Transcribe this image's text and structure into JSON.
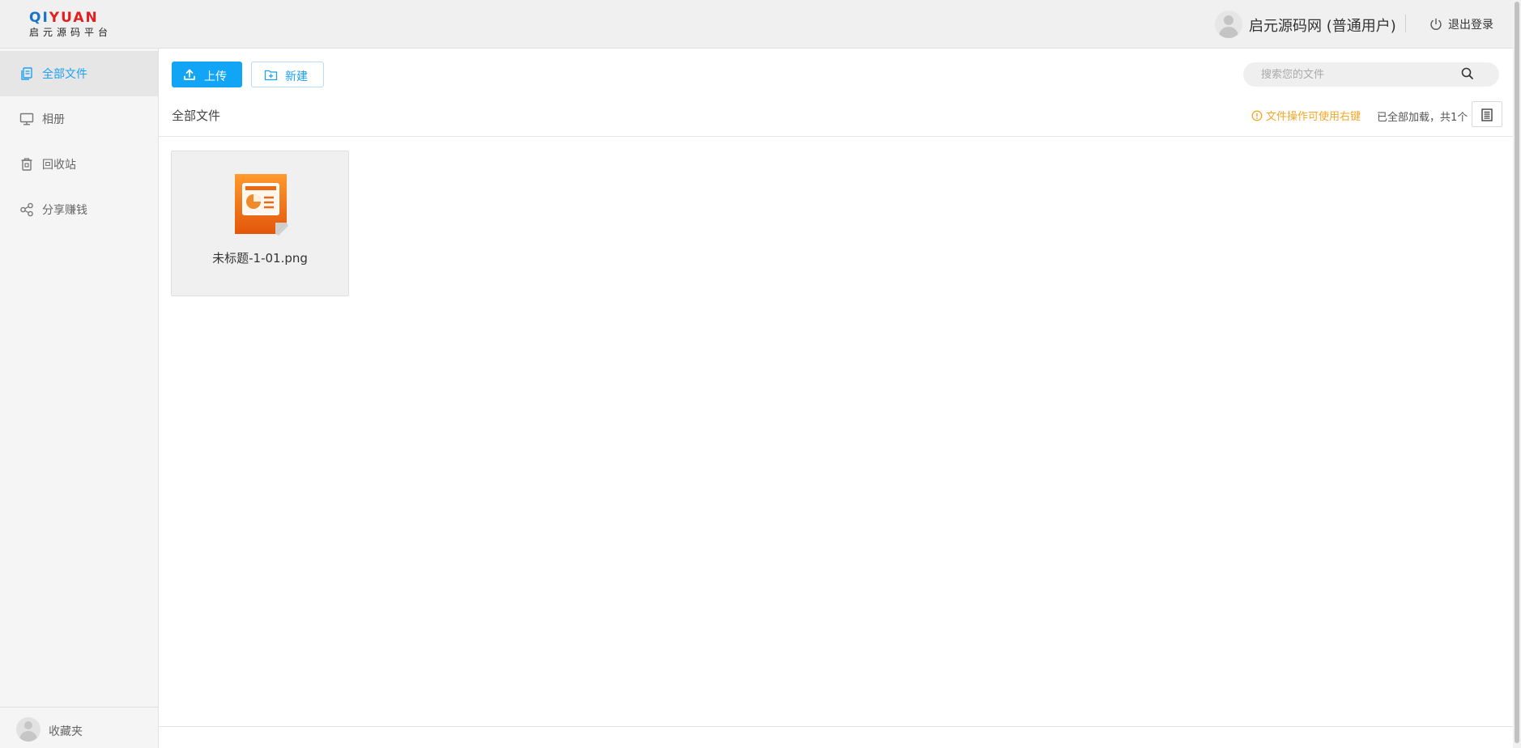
{
  "header": {
    "logo": {
      "top_text": "QIYUAN",
      "bottom_text": "启元源码平台"
    },
    "user_name": "启元源码网 (普通用户)",
    "logout_label": "退出登录"
  },
  "sidebar": {
    "items": [
      {
        "label": "全部文件",
        "icon": "files-icon",
        "active": true
      },
      {
        "label": "相册",
        "icon": "monitor-icon",
        "active": false
      },
      {
        "label": "回收站",
        "icon": "trash-icon",
        "active": false
      },
      {
        "label": "分享赚钱",
        "icon": "share-icon",
        "active": false
      }
    ],
    "footer_label": "收藏夹"
  },
  "toolbar": {
    "upload_label": "上传",
    "new_label": "新建",
    "search_placeholder": "搜索您的文件"
  },
  "content": {
    "breadcrumb": "全部文件",
    "tip": "文件操作可使用右键",
    "load_status": "已全部加载，共1个",
    "files": [
      {
        "name": "未标题-1-01.png",
        "icon": "presentation-file-icon"
      }
    ]
  },
  "colors": {
    "accent": "#12a5f5",
    "active_text": "#1da1f2",
    "tip": "#f5a623",
    "file_icon": "#f07a12"
  }
}
